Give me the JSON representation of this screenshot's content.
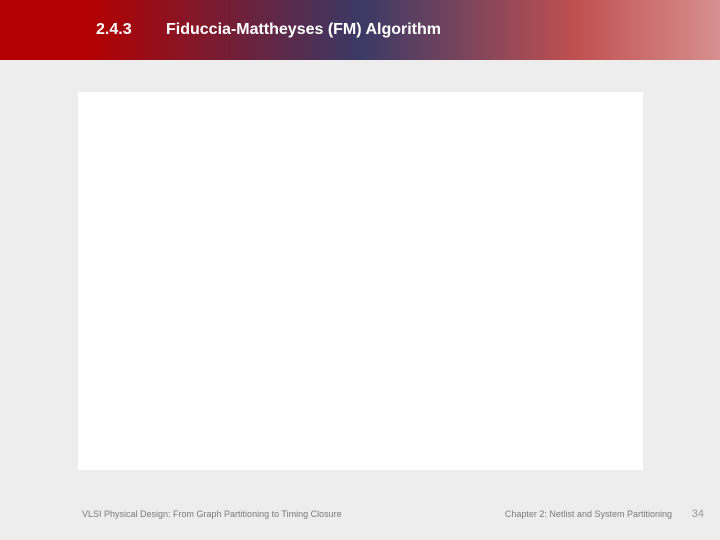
{
  "header": {
    "section_number": "2.4.3",
    "title": "Fiduccia-Mattheyses (FM) Algorithm"
  },
  "footer": {
    "left": "VLSI Physical Design: From Graph Partitioning to Timing Closure",
    "right": "Chapter 2: Netlist and System Partitioning",
    "page": "34"
  }
}
